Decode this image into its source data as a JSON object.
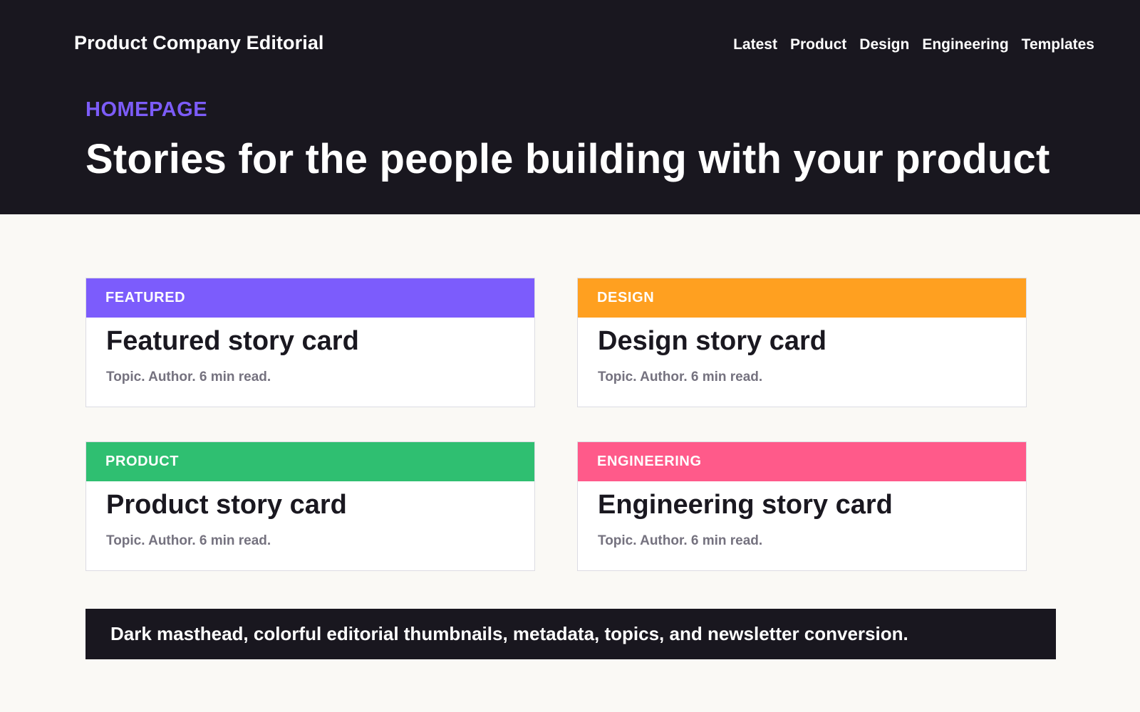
{
  "header": {
    "brand": "Product Company Editorial",
    "nav": [
      "Latest",
      "Product",
      "Design",
      "Engineering",
      "Templates"
    ],
    "eyebrow": "HOMEPAGE",
    "headline": "Stories for the people building with your product"
  },
  "cards": [
    {
      "tag": "FEATURED",
      "title": "Featured story card",
      "meta": "Topic. Author. 6 min read.",
      "color": "#7c5cfc"
    },
    {
      "tag": "DESIGN",
      "title": "Design story card",
      "meta": "Topic. Author. 6 min read.",
      "color": "#ffa020"
    },
    {
      "tag": "PRODUCT",
      "title": "Product story card",
      "meta": "Topic. Author. 6 min read.",
      "color": "#2fbf71"
    },
    {
      "tag": "ENGINEERING",
      "title": "Engineering story card",
      "meta": "Topic. Author. 6 min read.",
      "color": "#ff5a8a"
    }
  ],
  "footer": {
    "text": "Dark masthead, colorful editorial thumbnails, metadata, topics, and newsletter conversion."
  },
  "colors": {
    "masthead": "#19171f",
    "accent": "#7c5cf8",
    "page_bg": "#faf9f5"
  }
}
